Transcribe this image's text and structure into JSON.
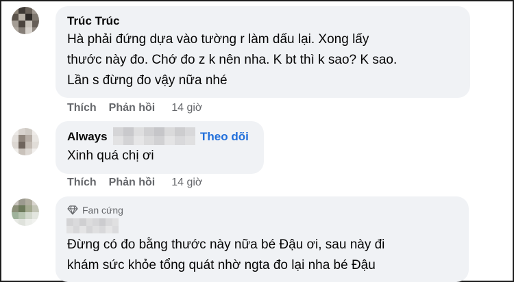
{
  "comments": [
    {
      "author": "Trúc Trúc",
      "lines": [
        "Hà phải đứng dựa vào tường r làm dấu lại. Xong lấy",
        "thước này đo. Chớ đo z k nên nha. K bt thì k sao? K sao.",
        "Lần s đừng đo vậy nữa nhé"
      ],
      "actions": {
        "like": "Thích",
        "reply": "Phản hồi",
        "time": "14 giờ"
      }
    },
    {
      "author": "Always",
      "follow": "Theo dõi",
      "lines": [
        "Xinh quá chị ơi"
      ],
      "actions": {
        "like": "Thích",
        "reply": "Phản hồi",
        "time": "14 giờ"
      }
    },
    {
      "badge": "Fan cứng",
      "lines": [
        "Đừng có đo bằng thước này nữa bé Đậu ơi, sau này đi",
        "khám sức khỏe tổng quát nhờ ngta đo lại nha bé Đậu"
      ]
    }
  ],
  "colors": {
    "bubble": "#f0f2f5",
    "secondary_text": "#65676b",
    "link": "#216fdb",
    "border": "#1c1c1c"
  },
  "icons": {
    "fan_badge": "diamond-icon"
  }
}
